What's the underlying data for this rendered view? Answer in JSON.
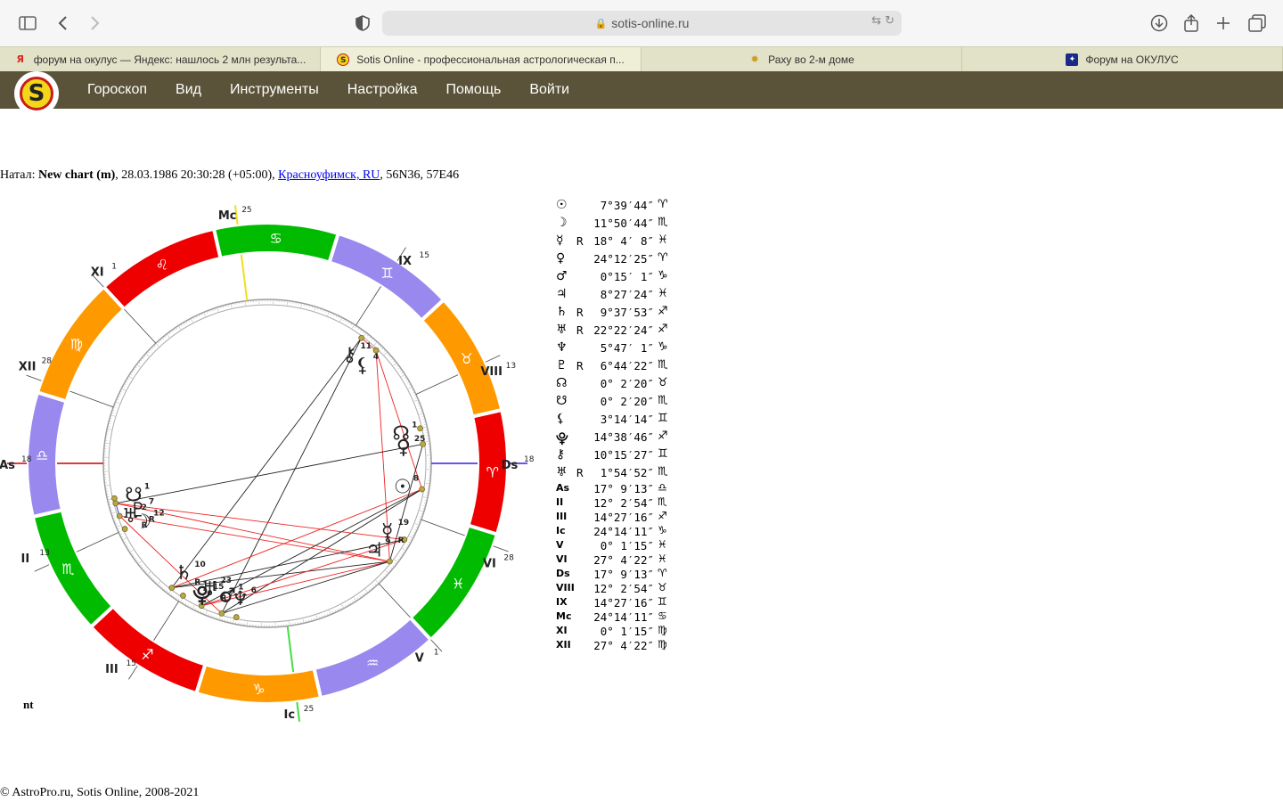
{
  "browser": {
    "url": "sotis-online.ru",
    "tabs": [
      {
        "label": "форум на окулус — Яндекс: нашлось 2 млн результа...",
        "favicon": "Я",
        "active": false
      },
      {
        "label": "Sotis Online - профессиональная астрологическая п...",
        "favicon": "S",
        "active": true
      },
      {
        "label": "Раху во 2-м доме",
        "favicon": "✹",
        "active": false
      },
      {
        "label": "Форум на ОКУЛУС",
        "favicon": "✦",
        "active": false
      }
    ]
  },
  "nav": {
    "items": [
      "Гороскоп",
      "Вид",
      "Инструменты",
      "Настройка",
      "Помощь",
      "Войти"
    ]
  },
  "chart": {
    "prefix": "Натал: ",
    "name": "New chart (m)",
    "datetime": ", 28.03.1986 20:30:28 (+05:00), ",
    "place": "Красноуфимск, RU",
    "coords": ", 56N36, 57E46",
    "footnote": "nt"
  },
  "wheel": {
    "asc_deg": 197.15,
    "mc_deg": 114.24,
    "houses": [
      {
        "num": "As",
        "deg": 197.15,
        "label": "18",
        "angle": true
      },
      {
        "num": "II",
        "deg": 222.05,
        "label": "13"
      },
      {
        "num": "III",
        "deg": 254.45,
        "label": "15"
      },
      {
        "num": "Ic",
        "deg": 294.24,
        "label": "25",
        "angle": true
      },
      {
        "num": "V",
        "deg": 330.02,
        "label": "1"
      },
      {
        "num": "VI",
        "deg": 357.07,
        "label": "28"
      },
      {
        "num": "Ds",
        "deg": 17.15,
        "label": "18",
        "angle": true
      },
      {
        "num": "VIII",
        "deg": 42.05,
        "label": "13"
      },
      {
        "num": "IX",
        "deg": 74.45,
        "label": "15"
      },
      {
        "num": "Mc",
        "deg": 114.24,
        "label": "25",
        "angle": true
      },
      {
        "num": "XI",
        "deg": 150.02,
        "label": "1"
      },
      {
        "num": "XII",
        "deg": 177.07,
        "label": "28"
      }
    ],
    "signs": [
      {
        "glyph": "♈",
        "color": "#ee0000"
      },
      {
        "glyph": "♉",
        "color": "#ff9900"
      },
      {
        "glyph": "♊",
        "color": "#9988ee"
      },
      {
        "glyph": "♋",
        "color": "#00bb00"
      },
      {
        "glyph": "♌",
        "color": "#ee0000"
      },
      {
        "glyph": "♍",
        "color": "#ff9900"
      },
      {
        "glyph": "♎",
        "color": "#9988ee"
      },
      {
        "glyph": "♏",
        "color": "#00bb00"
      },
      {
        "glyph": "♐",
        "color": "#ee0000"
      },
      {
        "glyph": "♑",
        "color": "#ff9900"
      },
      {
        "glyph": "♒",
        "color": "#9988ee"
      },
      {
        "glyph": "♓",
        "color": "#00bb00"
      }
    ],
    "bodies": [
      {
        "key": "sun",
        "glyph": "☉",
        "deg": 7.66,
        "label": "8",
        "retro": false
      },
      {
        "key": "moon",
        "glyph": "☽",
        "deg": 221.85,
        "label": "12",
        "retro": false
      },
      {
        "key": "mercury",
        "glyph": "☿",
        "deg": 348.07,
        "label": "19",
        "retro": true
      },
      {
        "key": "venus",
        "glyph": "♀",
        "deg": 24.2,
        "label": "25",
        "retro": false
      },
      {
        "key": "mars",
        "glyph": "♂",
        "deg": 270.25,
        "label": "1",
        "retro": false
      },
      {
        "key": "jupiter",
        "glyph": "♃",
        "deg": 338.46,
        "label": "9",
        "retro": false
      },
      {
        "key": "saturn",
        "glyph": "♄",
        "deg": 249.63,
        "label": "10",
        "retro": true
      },
      {
        "key": "uranus",
        "glyph": "♅",
        "deg": 262.37,
        "label": "23",
        "retro": true
      },
      {
        "key": "neptune",
        "glyph": "♆",
        "deg": 275.78,
        "label": "6",
        "retro": false
      },
      {
        "key": "pluto",
        "glyph": "♇",
        "deg": 216.74,
        "label": "7",
        "retro": true
      },
      {
        "key": "node",
        "glyph": "☊",
        "deg": 30.04,
        "label": "1",
        "retro": false
      },
      {
        "key": "snode",
        "glyph": "☋",
        "deg": 210.04,
        "label": "1",
        "retro": false
      },
      {
        "key": "lilith",
        "glyph": "⚸",
        "deg": 63.24,
        "label": "4",
        "retro": false
      },
      {
        "key": "proserpina",
        "glyph": "⯓",
        "deg": 254.65,
        "label": "15",
        "retro": false
      },
      {
        "key": "chiron",
        "glyph": "⚷",
        "deg": 70.25,
        "label": "11",
        "retro": false
      },
      {
        "key": "uranus2",
        "glyph": "♅",
        "deg": 211.91,
        "label": "2",
        "retro": true
      }
    ]
  },
  "positions": [
    {
      "glyph": "☉",
      "retro": "",
      "deg": "7°39′44″",
      "sign": "♈"
    },
    {
      "glyph": "☽",
      "retro": "",
      "deg": "11°50′44″",
      "sign": "♏"
    },
    {
      "glyph": "☿",
      "retro": "R",
      "deg": "18° 4′ 8″",
      "sign": "♓"
    },
    {
      "glyph": "♀",
      "retro": "",
      "deg": "24°12′25″",
      "sign": "♈"
    },
    {
      "glyph": "♂",
      "retro": "",
      "deg": "0°15′ 1″",
      "sign": "♑"
    },
    {
      "glyph": "♃",
      "retro": "",
      "deg": "8°27′24″",
      "sign": "♓"
    },
    {
      "glyph": "♄",
      "retro": "R",
      "deg": "9°37′53″",
      "sign": "♐"
    },
    {
      "glyph": "♅",
      "retro": "R",
      "deg": "22°22′24″",
      "sign": "♐"
    },
    {
      "glyph": "♆",
      "retro": "",
      "deg": "5°47′ 1″",
      "sign": "♑"
    },
    {
      "glyph": "♇",
      "retro": "R",
      "deg": "6°44′22″",
      "sign": "♏"
    },
    {
      "glyph": "☊",
      "retro": "",
      "deg": "0° 2′20″",
      "sign": "♉"
    },
    {
      "glyph": "☋",
      "retro": "",
      "deg": "0° 2′20″",
      "sign": "♏"
    },
    {
      "glyph": "⚸",
      "retro": "",
      "deg": "3°14′14″",
      "sign": "♊"
    },
    {
      "glyph": "⯓",
      "retro": "",
      "deg": "14°38′46″",
      "sign": "♐"
    },
    {
      "glyph": "⚷",
      "retro": "",
      "deg": "10°15′27″",
      "sign": "♊"
    },
    {
      "glyph": "♅",
      "retro": "R",
      "deg": "1°54′52″",
      "sign": "♏"
    }
  ],
  "cusps": [
    {
      "glyph": "As",
      "deg": "17° 9′13″",
      "sign": "♎"
    },
    {
      "glyph": "II",
      "deg": "12° 2′54″",
      "sign": "♏"
    },
    {
      "glyph": "III",
      "deg": "14°27′16″",
      "sign": "♐"
    },
    {
      "glyph": "Ic",
      "deg": "24°14′11″",
      "sign": "♑"
    },
    {
      "glyph": "V",
      "deg": "0° 1′15″",
      "sign": "♓"
    },
    {
      "glyph": "VI",
      "deg": "27° 4′22″",
      "sign": "♓"
    },
    {
      "glyph": "Ds",
      "deg": "17° 9′13″",
      "sign": "♈"
    },
    {
      "glyph": "VIII",
      "deg": "12° 2′54″",
      "sign": "♉"
    },
    {
      "glyph": "IX",
      "deg": "14°27′16″",
      "sign": "♊"
    },
    {
      "glyph": "Mc",
      "deg": "24°14′11″",
      "sign": "♋"
    },
    {
      "glyph": "XI",
      "deg": "0° 1′15″",
      "sign": "♍"
    },
    {
      "glyph": "XII",
      "deg": "27° 4′22″",
      "sign": "♍"
    }
  ],
  "footer": "© AstroPro.ru, Sotis Online, 2008-2021"
}
